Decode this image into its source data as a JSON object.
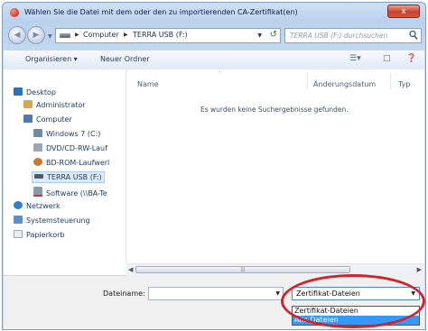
{
  "window": {
    "title": "Wählen Sie die Datei mit dem oder den zu importierenden CA-Zertifikat(en)",
    "close_label": "x"
  },
  "address": {
    "crumbs": [
      "Computer",
      "TERRA USB (F:)"
    ],
    "search_placeholder": "TERRA USB (F:) durchsuchen"
  },
  "toolbar": {
    "organize": "Organisieren ▾",
    "new_folder": "Neuer Ordner"
  },
  "nav": {
    "items": [
      {
        "label": "Desktop",
        "icon": "desktop-icon"
      },
      {
        "label": "Administrator",
        "icon": "user-icon"
      },
      {
        "label": "Computer",
        "icon": "computer-icon"
      },
      {
        "label": "Windows 7 (C:)",
        "icon": "drive-icon"
      },
      {
        "label": "DVD/CD-RW-Lauf",
        "icon": "dvd-icon"
      },
      {
        "label": "BD-ROM-Laufwerl",
        "icon": "bdrom-icon"
      },
      {
        "label": "TERRA USB (F:)",
        "icon": "usb-drive-icon"
      },
      {
        "label": "Software (\\\\BA-Te",
        "icon": "network-drive-icon"
      },
      {
        "label": "Netzwerk",
        "icon": "network-icon"
      },
      {
        "label": "Systemsteuerung",
        "icon": "control-panel-icon"
      },
      {
        "label": "Papierkorb",
        "icon": "recycle-bin-icon"
      }
    ]
  },
  "list": {
    "columns": [
      "Name",
      "Änderungsdatum",
      "Typ"
    ],
    "empty_message": "Es wurden keine Suchergebnisse gefunden."
  },
  "footer": {
    "filename_label": "Dateiname:",
    "filename_value": "",
    "filter_selected": "Zertifikat-Dateien",
    "filter_options": [
      "Zertifikat-Dateien",
      "Alle Dateien"
    ],
    "highlighted_option": "Alle Dateien"
  },
  "colors": {
    "annotation_oval": "#d2222b",
    "highlight": "#3399ff",
    "close_button": "#c9412a"
  }
}
